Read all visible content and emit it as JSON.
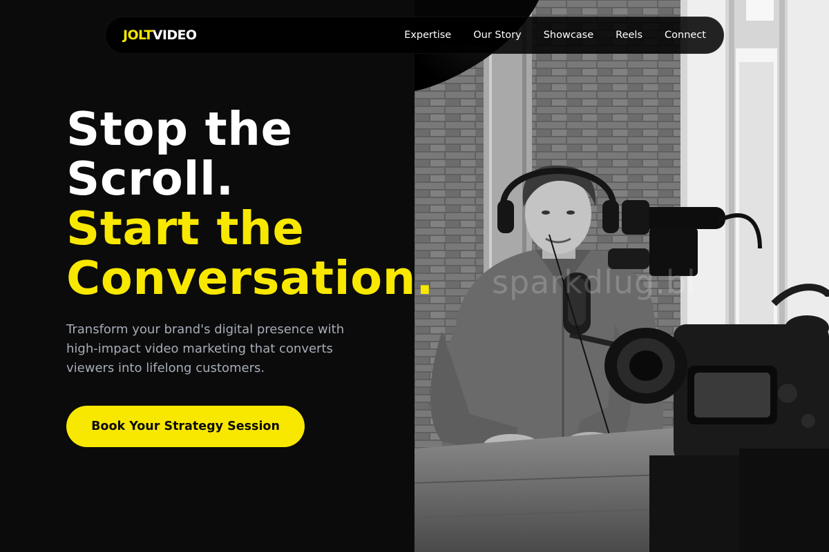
{
  "brand": {
    "logo_part1": "JOLT",
    "logo_part2": "VIDEO",
    "accent_color": "#f8e800"
  },
  "nav": {
    "links": [
      {
        "label": "Expertise"
      },
      {
        "label": "Our Story"
      },
      {
        "label": "Showcase"
      },
      {
        "label": "Reels"
      },
      {
        "label": "Connect"
      }
    ]
  },
  "hero": {
    "title_line1": "Stop the",
    "title_line2": "Scroll.",
    "title_line3": "Start the",
    "title_line4": "Conversation.",
    "subtitle": "Transform your brand's digital presence with high-impact video marketing that converts viewers into lifelong customers.",
    "cta_label": "Book Your Strategy Session"
  },
  "photo": {
    "watermark": "sparkdlug.bl",
    "description_icon": "podcast-photo"
  }
}
